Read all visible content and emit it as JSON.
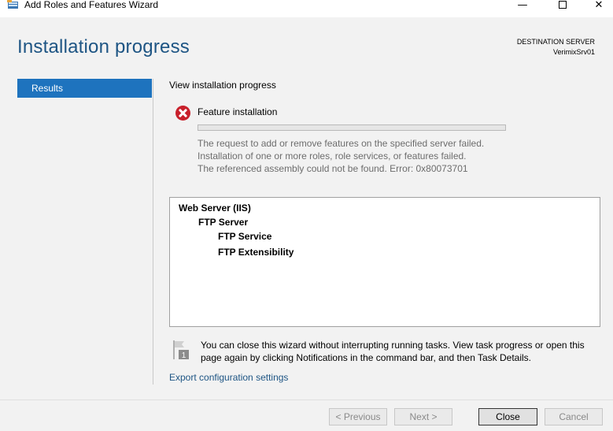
{
  "window": {
    "title": "Add Roles and Features Wizard",
    "minimize_glyph": "—",
    "close_glyph": "✕"
  },
  "header": {
    "page_title": "Installation progress",
    "destination_label": "DESTINATION SERVER",
    "destination_server": "VerimixSrv01"
  },
  "sidebar": {
    "items": [
      {
        "label": "Results",
        "selected": true
      }
    ]
  },
  "main": {
    "heading": "View installation progress",
    "status": {
      "icon": "error-icon",
      "title": "Feature installation",
      "progress": 0,
      "messages": [
        "The request to add or remove features on the specified server failed.",
        "Installation of one or more roles, role services, or features failed.",
        "The referenced assembly could not be found. Error: 0x80073701"
      ]
    },
    "features": [
      {
        "label": "Web Server (IIS)",
        "level": 0
      },
      {
        "label": "FTP Server",
        "level": 1
      },
      {
        "label": "FTP Service",
        "level": 2
      },
      {
        "label": "FTP Extensibility",
        "level": 2
      }
    ],
    "hint_badge": "1",
    "hint": "You can close this wizard without interrupting running tasks. View task progress or open this page again by clicking Notifications in the command bar, and then Task Details.",
    "export_link": "Export configuration settings"
  },
  "buttons": {
    "previous": "< Previous",
    "next": "Next >",
    "close": "Close",
    "cancel": "Cancel"
  },
  "colors": {
    "accent": "#1e73be",
    "title": "#1e5584",
    "error": "#c8202b"
  }
}
